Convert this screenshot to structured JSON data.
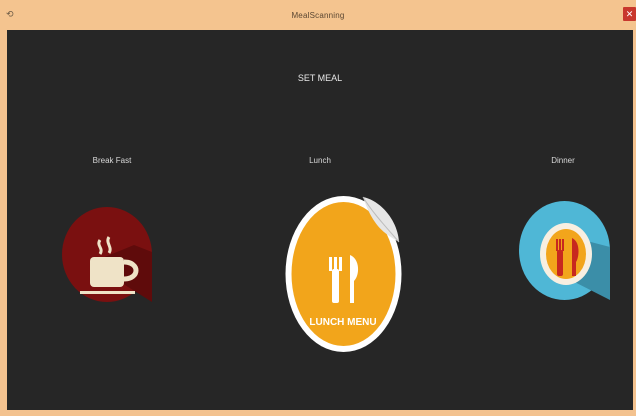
{
  "window": {
    "title": "MealScanning",
    "close_label": "✕",
    "app_icon": "back-arrow-icon"
  },
  "main": {
    "heading": "SET MEAL",
    "meals": [
      {
        "label": "Break Fast",
        "icon": "coffee-cup-icon",
        "color": "#7a1010"
      },
      {
        "label": "Lunch",
        "icon": "lunch-menu-icon",
        "color": "#f2a51b",
        "badge_text": "LUNCH MENU"
      },
      {
        "label": "Dinner",
        "icon": "fork-knife-plate-icon",
        "color": "#4fb7d6"
      }
    ]
  }
}
